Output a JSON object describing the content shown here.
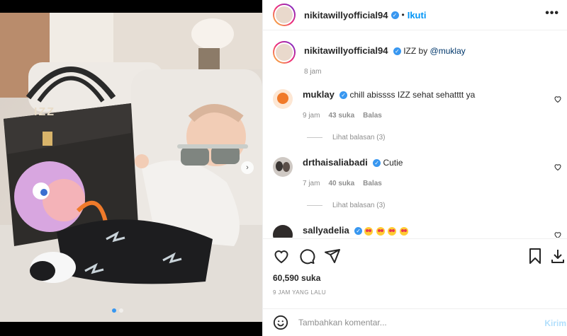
{
  "post": {
    "author": "nikitawillyofficial94",
    "follow_label": "Ikuti",
    "separator": "•",
    "more_label": "•••",
    "caption_author": "nikitawillyofficial94",
    "caption_text": "IZZ by",
    "caption_mention": "@muklay",
    "caption_time": "8 jam",
    "bag_text": "IZZ"
  },
  "comments": [
    {
      "user": "muklay",
      "text": "chill abissss IZZ sehat sehatttt ya",
      "time": "9 jam",
      "likes": "43 suka",
      "reply": "Balas",
      "replies": "Lihat balasan (3)"
    },
    {
      "user": "drthaisaliabadi",
      "text": "Cutie",
      "time": "7 jam",
      "likes": "40 suka",
      "reply": "Balas",
      "replies": "Lihat balasan (3)"
    },
    {
      "user": "sallyadelia",
      "emoji_count": 4
    }
  ],
  "stats": {
    "likes": "60,590 suka",
    "posted": "9 JAM YANG LALU"
  },
  "composer": {
    "placeholder": "Tambahkan komentar...",
    "send_label": "Kirim"
  },
  "icons": [
    "like-icon",
    "comment-icon",
    "share-icon",
    "save-icon",
    "download-icon",
    "emoji-icon"
  ],
  "colors": {
    "accent": "#0095f6",
    "verified": "#3897f0",
    "text": "#262626",
    "muted": "#8e8e8e"
  }
}
